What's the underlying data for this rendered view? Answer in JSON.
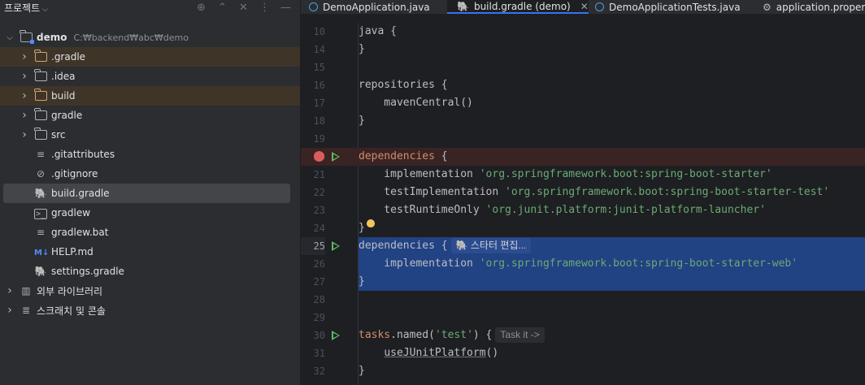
{
  "project_panel": {
    "title": "프로젝트",
    "header_icons": [
      "crosshair-icon",
      "expand-icon",
      "collapse-icon",
      "more-icon",
      "minimize-icon"
    ],
    "tree": [
      {
        "label": "demo",
        "path": "C:₩backend₩abc₩demo",
        "type": "module-folder",
        "expanded": true,
        "level": 0
      },
      {
        "label": ".gradle",
        "type": "folder-excluded",
        "expanded": false,
        "level": 1
      },
      {
        "label": ".idea",
        "type": "folder",
        "expanded": false,
        "level": 1
      },
      {
        "label": "build",
        "type": "folder-excluded",
        "expanded": false,
        "level": 1
      },
      {
        "label": "gradle",
        "type": "folder",
        "expanded": false,
        "level": 1
      },
      {
        "label": "src",
        "type": "folder",
        "expanded": false,
        "level": 1
      },
      {
        "label": ".gitattributes",
        "type": "text-file",
        "level": 1
      },
      {
        "label": ".gitignore",
        "type": "ignore-file",
        "level": 1
      },
      {
        "label": "build.gradle",
        "type": "gradle-file",
        "level": 1,
        "selected": true
      },
      {
        "label": "gradlew",
        "type": "shell-file",
        "level": 1
      },
      {
        "label": "gradlew.bat",
        "type": "text-file",
        "level": 1
      },
      {
        "label": "HELP.md",
        "type": "markdown-file",
        "level": 1
      },
      {
        "label": "settings.gradle",
        "type": "gradle-file",
        "level": 1
      },
      {
        "label": "외부 라이브러리",
        "type": "libraries",
        "expanded": false,
        "level": 0
      },
      {
        "label": "스크래치 및 콘솔",
        "type": "scratches",
        "expanded": false,
        "level": 0
      }
    ]
  },
  "tabs": [
    {
      "label": "DemoApplication.java",
      "icon": "java-class-icon",
      "active": false
    },
    {
      "label": "build.gradle (demo)",
      "icon": "gradle-icon",
      "active": true
    },
    {
      "label": "DemoApplicationTests.java",
      "icon": "java-class-icon",
      "active": false
    },
    {
      "label": "application.properti",
      "icon": "properties-icon",
      "active": false
    }
  ],
  "editor": {
    "lines": [
      {
        "num": "10",
        "tokens": [
          [
            "p",
            "java {"
          ]
        ]
      },
      {
        "num": "14",
        "tokens": [
          [
            "p",
            "}"
          ]
        ]
      },
      {
        "num": "15",
        "tokens": []
      },
      {
        "num": "16",
        "tokens": [
          [
            "p",
            "repositories {"
          ]
        ]
      },
      {
        "num": "17",
        "tokens": [
          [
            "p",
            "    mavenCentral()"
          ]
        ]
      },
      {
        "num": "18",
        "tokens": [
          [
            "p",
            "}"
          ]
        ]
      },
      {
        "num": "19",
        "tokens": []
      },
      {
        "num": "20",
        "tokens": [
          [
            "k",
            "dependencies"
          ],
          [
            "p",
            " {"
          ]
        ],
        "breakpoint": true,
        "run": true
      },
      {
        "num": "21",
        "tokens": [
          [
            "p",
            "    implementation "
          ],
          [
            "s",
            "'org.springframework.boot:spring-boot-starter'"
          ]
        ]
      },
      {
        "num": "22",
        "tokens": [
          [
            "p",
            "    testImplementation "
          ],
          [
            "s",
            "'org.springframework.boot:spring-boot-starter-test'"
          ]
        ]
      },
      {
        "num": "23",
        "tokens": [
          [
            "p",
            "    testRuntimeOnly "
          ],
          [
            "s",
            "'org.junit.platform:junit-platform-launcher'"
          ]
        ]
      },
      {
        "num": "24",
        "tokens": [
          [
            "p",
            "}"
          ]
        ],
        "bulb": true
      },
      {
        "num": "25",
        "tokens": [
          [
            "p",
            "dependencies {"
          ]
        ],
        "selected": true,
        "current": true,
        "run": true,
        "hint": "스타터 편집..."
      },
      {
        "num": "26",
        "tokens": [
          [
            "p",
            "    implementation "
          ],
          [
            "s",
            "'org.springframework.boot:spring-boot-starter-web'"
          ]
        ],
        "selected": true
      },
      {
        "num": "27",
        "tokens": [
          [
            "p",
            "}"
          ]
        ],
        "selected": true
      },
      {
        "num": "28",
        "tokens": []
      },
      {
        "num": "29",
        "tokens": []
      },
      {
        "num": "30",
        "tokens": [
          [
            "k",
            "tasks"
          ],
          [
            "p",
            ".named("
          ],
          [
            "s",
            "'test'"
          ],
          [
            "p",
            ") {"
          ]
        ],
        "run": true,
        "hint": "Task it ->"
      },
      {
        "num": "31",
        "tokens": [
          [
            "p",
            "    "
          ],
          [
            "u",
            "useJUnitPlatform"
          ],
          [
            "p",
            "()"
          ]
        ]
      },
      {
        "num": "32",
        "tokens": [
          [
            "p",
            "}"
          ]
        ]
      }
    ]
  },
  "colors": {
    "accent": "#3574f0",
    "selection": "#214283",
    "keyword": "#cf8e6d",
    "string": "#6aab73",
    "breakpoint": "#db5c5c",
    "run": "#5fb865",
    "excluded_folder": "#d4a373"
  }
}
